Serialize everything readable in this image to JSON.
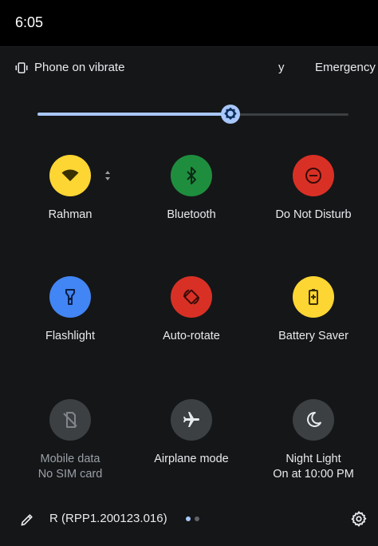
{
  "status_bar": {
    "time": "6:05"
  },
  "header": {
    "vibrate_label": "Phone on vibrate",
    "carrier_fragment": "y",
    "emergency_label": "Emergency"
  },
  "brightness": {
    "level": 0.62
  },
  "tiles": [
    {
      "label": "Rahman",
      "sublabel": "",
      "icon": "wifi-icon",
      "color": "#fdd633",
      "active": true
    },
    {
      "label": "Bluetooth",
      "sublabel": "",
      "icon": "bluetooth-icon",
      "color": "#1e8e3e",
      "active": true
    },
    {
      "label": "Do Not Disturb",
      "sublabel": "",
      "icon": "do-not-disturb-icon",
      "color": "#d93025",
      "active": true
    },
    {
      "label": "Flashlight",
      "sublabel": "",
      "icon": "flashlight-icon",
      "color": "#4285f4",
      "active": true
    },
    {
      "label": "Auto-rotate",
      "sublabel": "",
      "icon": "auto-rotate-icon",
      "color": "#d93025",
      "active": true
    },
    {
      "label": "Battery Saver",
      "sublabel": "",
      "icon": "battery-saver-icon",
      "color": "#fdd633",
      "active": true
    },
    {
      "label": "Mobile data",
      "sublabel": "No SIM card",
      "icon": "mobile-data-off-icon",
      "color": "#3c4043",
      "active": false
    },
    {
      "label": "Airplane mode",
      "sublabel": "",
      "icon": "airplane-icon",
      "color": "#3c4043",
      "active": false
    },
    {
      "label": "Night Light",
      "sublabel": "On at 10:00 PM",
      "icon": "night-light-icon",
      "color": "#3c4043",
      "active": false
    }
  ],
  "footer": {
    "build": "R (RPP1.200123.016)",
    "pages": 2,
    "current_page": 1,
    "edit_icon": "edit-icon",
    "settings_icon": "settings-icon"
  },
  "colors": {
    "accent": "#a8c7fa",
    "background": "#151618",
    "dot_active": "#a8c7fa",
    "dot_inactive": "#5f6368"
  }
}
